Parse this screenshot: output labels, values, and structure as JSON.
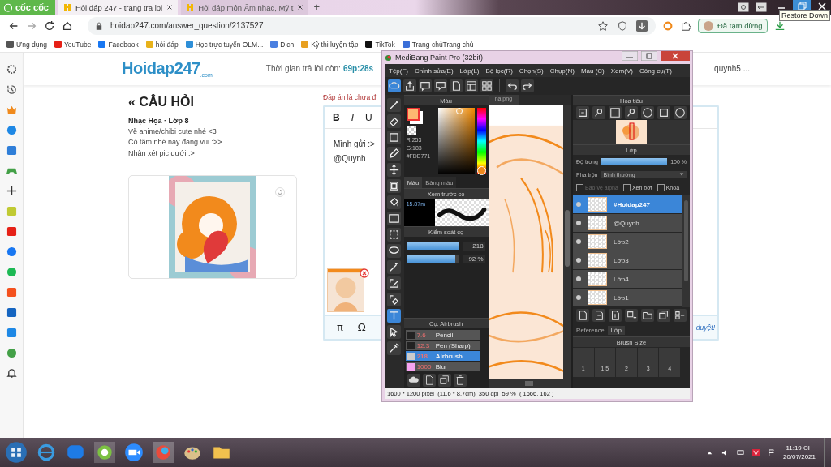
{
  "browser": {
    "brand": "cốc cốc",
    "tabs": [
      {
        "label": "Hỏi đáp 247 - trang tra loi",
        "selected": true
      },
      {
        "label": "Hỏi đáp môn Âm nhạc, Mỹ t",
        "selected": false
      }
    ],
    "new_tab": "+",
    "tooltip": "Restore Down",
    "url": "hoidap247.com/answer_question/2137527",
    "profile": "Đã tạm dừng",
    "bookmarks": [
      "Ứng dụng",
      "YouTube",
      "Facebook",
      "hỏi đáp",
      "Học trực tuyến OLM...",
      "Dịch",
      "Kỳ thi luyện tập",
      "TikTok",
      "Trang chủTrang chủ"
    ]
  },
  "page": {
    "logo": "Hoidap247",
    "logo_suffix": ".com",
    "timer_label": "Thời gian trả lời còn:",
    "timer": "69p:28s",
    "user": "quynh5 ...",
    "heading": "« CÂU HỎI",
    "subject": "Nhạc Họa · Lớp 8",
    "question": [
      "Vẽ anime/chibi cute nhé <3",
      "Có tâm nhé nay đang vui :>>",
      "Nhận xét pic dưới :>"
    ],
    "warning": "Đáp án là chưa đ",
    "editor": {
      "tools": [
        "B",
        "I",
        "U"
      ],
      "lines": [
        "Mình gửi :>",
        "@Quynh"
      ],
      "bottom_tools": [
        "π",
        "Ω"
      ],
      "note": "duyệt!"
    }
  },
  "medibang": {
    "title": "MediBang Paint Pro (32bit)",
    "menu": [
      "Tệp(F)",
      "Chỉnh sửa(E)",
      "Lớp(L)",
      "Bộ lọc(R)",
      "Chọn(S)",
      "Chụp(N)",
      "Màu (C)",
      "Xem(V)",
      "Công cụ(T)"
    ],
    "tools": [
      {
        "selected": false
      },
      {
        "selected": false
      },
      {
        "selected": false
      },
      {
        "selected": false
      },
      {
        "selected": false
      },
      {
        "selected": false
      },
      {
        "selected": false
      },
      {
        "selected": false
      },
      {
        "selected": false
      },
      {
        "selected": false
      },
      {
        "selected": false
      },
      {
        "selected": false
      },
      {
        "selected": false
      },
      {
        "selected": true
      },
      {
        "selected": false
      },
      {
        "selected": false
      }
    ],
    "color_panel": {
      "title": "Màu",
      "values": [
        "R:253",
        "G:183",
        "#FDB771"
      ],
      "tabs": [
        {
          "label": "Màu",
          "selected": true
        },
        {
          "label": "Bảng màu",
          "selected": false
        }
      ]
    },
    "preview_panel": {
      "title": "Xem trước cọ",
      "size": "15.87m"
    },
    "brush_control": {
      "title": "Kiểm soát cọ",
      "sliders": [
        {
          "level": 1,
          "reading": "218"
        },
        {
          "level": 0.92,
          "reading": "92 %"
        }
      ]
    },
    "brush_panel": {
      "title": "Cọ: Airbrush",
      "brushes": [
        {
          "size": "7.6",
          "name": "Pencil",
          "color": "#222222",
          "selected": false
        },
        {
          "size": "12.3",
          "name": "Pen (Sharp)",
          "color": "#222222",
          "selected": false
        },
        {
          "size": "218",
          "name": "Airbrush",
          "color": "#cccccc",
          "selected": true
        },
        {
          "size": "1000",
          "name": "Blur",
          "color": "#f5a3f0",
          "selected": false
        }
      ]
    },
    "canvas_tab": "na.png",
    "navigator": {
      "title": "Hoa tiêu"
    },
    "layer_panel": {
      "title": "Lớp",
      "opacity_label": "Độ trong",
      "opacity": {
        "level": 1,
        "reading": "100 %"
      },
      "blend_label": "Pha trộn",
      "blend": "Bình thường",
      "options": [
        {
          "label": "Bảo vệ alpha",
          "checked": false,
          "disabled": true
        },
        {
          "label": "Xén bớt",
          "checked": false,
          "disabled": false
        },
        {
          "label": "Khóa",
          "checked": false,
          "disabled": false
        }
      ],
      "layers": [
        {
          "name": "#Hoidap247",
          "selected": true
        },
        {
          "name": "@Quynh",
          "selected": false
        },
        {
          "name": "Lớp2",
          "selected": false
        },
        {
          "name": "Lớp3",
          "selected": false
        },
        {
          "name": "Lớp4",
          "selected": false
        },
        {
          "name": "Lớp1",
          "selected": false
        }
      ]
    },
    "dock_tabs": [
      {
        "label": "Reference",
        "selected": false
      },
      {
        "label": "Lớp",
        "selected": true
      }
    ],
    "brush_size": {
      "title": "Brush Size",
      "sizes": [
        "1",
        "1.5",
        "2",
        "3",
        "4"
      ]
    },
    "status": "1600 * 1200 pixel  (11.6 * 8.7cm)  350 dpi  59 %  ( 1666, 162 )"
  },
  "taskbar": {
    "time": "11:19 CH",
    "date": "20/07/2021"
  }
}
